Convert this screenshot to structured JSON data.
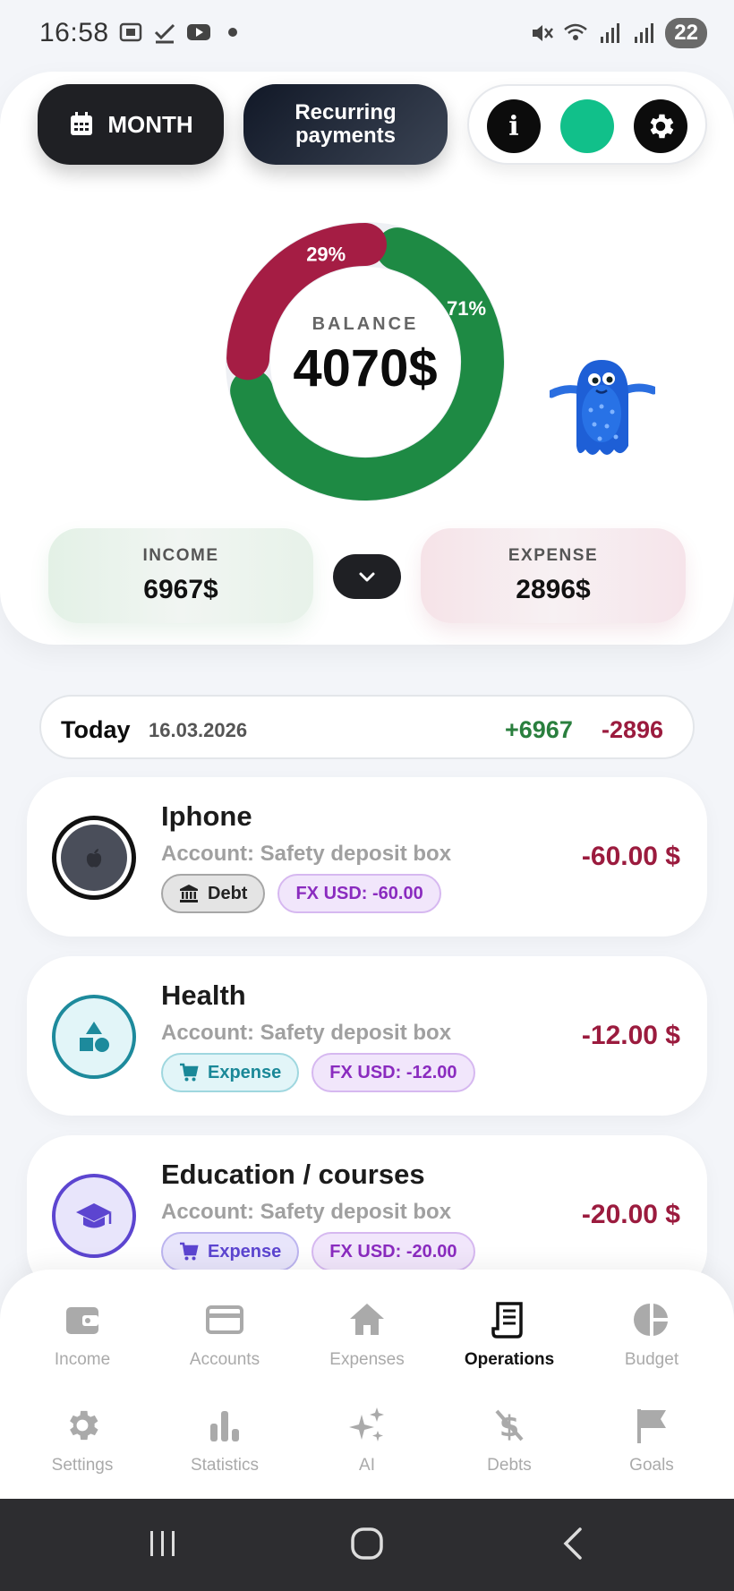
{
  "status_bar": {
    "time": "16:58",
    "battery": "22",
    "icons_left": [
      "screenshot-icon",
      "check-icon",
      "youtube-icon",
      "dot-icon"
    ],
    "icons_right": [
      "mute-icon",
      "wifi-icon",
      "signal-icon",
      "signal-icon"
    ]
  },
  "header": {
    "month_label": "MONTH",
    "recurring_line1": "Recurring",
    "recurring_line2": "payments",
    "info_label": "i"
  },
  "balance": {
    "label": "BALANCE",
    "value": "4070$",
    "expense_pct_label": "29%",
    "income_pct_label": "71%",
    "expense_fraction": 0.29,
    "income_fraction": 0.71,
    "expense_color": "#a51d44",
    "income_color": "#1e8a44"
  },
  "summary": {
    "income_label": "INCOME",
    "income_value": "6967$",
    "expense_label": "EXPENSE",
    "expense_value": "2896$"
  },
  "today": {
    "label": "Today",
    "date": "16.03.2026",
    "income": "+6967",
    "expense": "-2896"
  },
  "operations": [
    {
      "title": "Iphone",
      "account": "Account: Safety deposit box",
      "type_label": "Debt",
      "type_icon": "bank-icon",
      "fx": "FX USD: -60.00",
      "amount": "-60.00 $",
      "icon": "apple-icon"
    },
    {
      "title": "Health",
      "account": "Account: Safety deposit box",
      "type_label": "Expense",
      "type_icon": "cart-icon",
      "fx": "FX USD: -12.00",
      "amount": "-12.00 $",
      "icon": "shapes-icon"
    },
    {
      "title": "Education / courses",
      "account": "Account: Safety deposit box",
      "type_label": "Expense",
      "type_icon": "cart-icon",
      "fx": "FX USD: -20.00",
      "amount": "-20.00 $",
      "icon": "graduation-cap-icon"
    }
  ],
  "nav": {
    "row1": [
      {
        "label": "Income",
        "icon": "wallet-icon"
      },
      {
        "label": "Accounts",
        "icon": "card-icon"
      },
      {
        "label": "Expenses",
        "icon": "home-icon"
      },
      {
        "label": "Operations",
        "icon": "receipt-icon",
        "active": true
      },
      {
        "label": "Budget",
        "icon": "pie-icon"
      }
    ],
    "row2": [
      {
        "label": "Settings",
        "icon": "gear-icon"
      },
      {
        "label": "Statistics",
        "icon": "bar-chart-icon"
      },
      {
        "label": "AI",
        "icon": "sparkles-icon"
      },
      {
        "label": "Debts",
        "icon": "no-dollar-icon"
      },
      {
        "label": "Goals",
        "icon": "flag-icon"
      }
    ]
  }
}
